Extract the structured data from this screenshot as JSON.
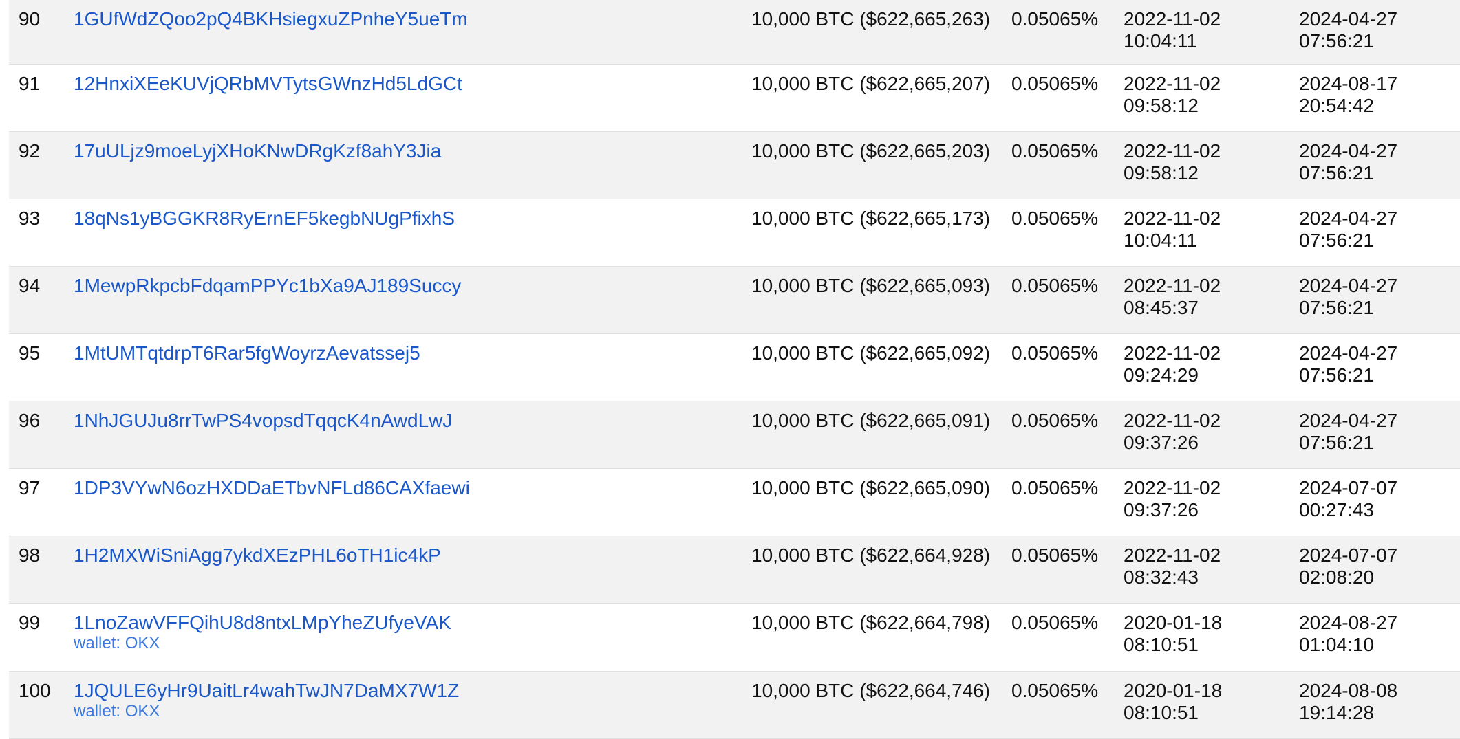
{
  "rows": [
    {
      "rank": "90",
      "address": "1GUfWdZQoo2pQ4BKHsiegxuZPnheY5ueTm",
      "wallet": "",
      "balance": "10,000 BTC ($622,665,263)",
      "percent": "0.05065%",
      "first_in_date": "2022-11-02",
      "first_in_time": "10:04:11",
      "last_in_date": "2024-04-27",
      "last_in_time": "07:56:21"
    },
    {
      "rank": "91",
      "address": "12HnxiXEeKUVjQRbMVTytsGWnzHd5LdGCt",
      "wallet": "",
      "balance": "10,000 BTC ($622,665,207)",
      "percent": "0.05065%",
      "first_in_date": "2022-11-02",
      "first_in_time": "09:58:12",
      "last_in_date": "2024-08-17",
      "last_in_time": "20:54:42"
    },
    {
      "rank": "92",
      "address": "17uULjz9moeLyjXHoKNwDRgKzf8ahY3Jia",
      "wallet": "",
      "balance": "10,000 BTC ($622,665,203)",
      "percent": "0.05065%",
      "first_in_date": "2022-11-02",
      "first_in_time": "09:58:12",
      "last_in_date": "2024-04-27",
      "last_in_time": "07:56:21"
    },
    {
      "rank": "93",
      "address": "18qNs1yBGGKR8RyErnEF5kegbNUgPfixhS",
      "wallet": "",
      "balance": "10,000 BTC ($622,665,173)",
      "percent": "0.05065%",
      "first_in_date": "2022-11-02",
      "first_in_time": "10:04:11",
      "last_in_date": "2024-04-27",
      "last_in_time": "07:56:21"
    },
    {
      "rank": "94",
      "address": "1MewpRkpcbFdqamPPYc1bXa9AJ189Succy",
      "wallet": "",
      "balance": "10,000 BTC ($622,665,093)",
      "percent": "0.05065%",
      "first_in_date": "2022-11-02",
      "first_in_time": "08:45:37",
      "last_in_date": "2024-04-27",
      "last_in_time": "07:56:21"
    },
    {
      "rank": "95",
      "address": "1MtUMTqtdrpT6Rar5fgWoyrzAevatssej5",
      "wallet": "",
      "balance": "10,000 BTC ($622,665,092)",
      "percent": "0.05065%",
      "first_in_date": "2022-11-02",
      "first_in_time": "09:24:29",
      "last_in_date": "2024-04-27",
      "last_in_time": "07:56:21"
    },
    {
      "rank": "96",
      "address": "1NhJGUJu8rrTwPS4vopsdTqqcK4nAwdLwJ",
      "wallet": "",
      "balance": "10,000 BTC ($622,665,091)",
      "percent": "0.05065%",
      "first_in_date": "2022-11-02",
      "first_in_time": "09:37:26",
      "last_in_date": "2024-04-27",
      "last_in_time": "07:56:21"
    },
    {
      "rank": "97",
      "address": "1DP3VYwN6ozHXDDaETbvNFLd86CAXfaewi",
      "wallet": "",
      "balance": "10,000 BTC ($622,665,090)",
      "percent": "0.05065%",
      "first_in_date": "2022-11-02",
      "first_in_time": "09:37:26",
      "last_in_date": "2024-07-07",
      "last_in_time": "00:27:43"
    },
    {
      "rank": "98",
      "address": "1H2MXWiSniAgg7ykdXEzPHL6oTH1ic4kP",
      "wallet": "",
      "balance": "10,000 BTC ($622,664,928)",
      "percent": "0.05065%",
      "first_in_date": "2022-11-02",
      "first_in_time": "08:32:43",
      "last_in_date": "2024-07-07",
      "last_in_time": "02:08:20"
    },
    {
      "rank": "99",
      "address": "1LnoZawVFFQihU8d8ntxLMpYheZUfyeVAK",
      "wallet": "wallet: OKX",
      "balance": "10,000 BTC ($622,664,798)",
      "percent": "0.05065%",
      "first_in_date": "2020-01-18",
      "first_in_time": "08:10:51",
      "last_in_date": "2024-08-27",
      "last_in_time": "01:04:10"
    },
    {
      "rank": "100",
      "address": "1JQULE6yHr9UaitLr4wahTwJN7DaMX7W1Z",
      "wallet": "wallet: OKX",
      "balance": "10,000 BTC ($622,664,746)",
      "percent": "0.05065%",
      "first_in_date": "2020-01-18",
      "first_in_time": "08:10:51",
      "last_in_date": "2024-08-08",
      "last_in_time": "19:14:28"
    }
  ]
}
